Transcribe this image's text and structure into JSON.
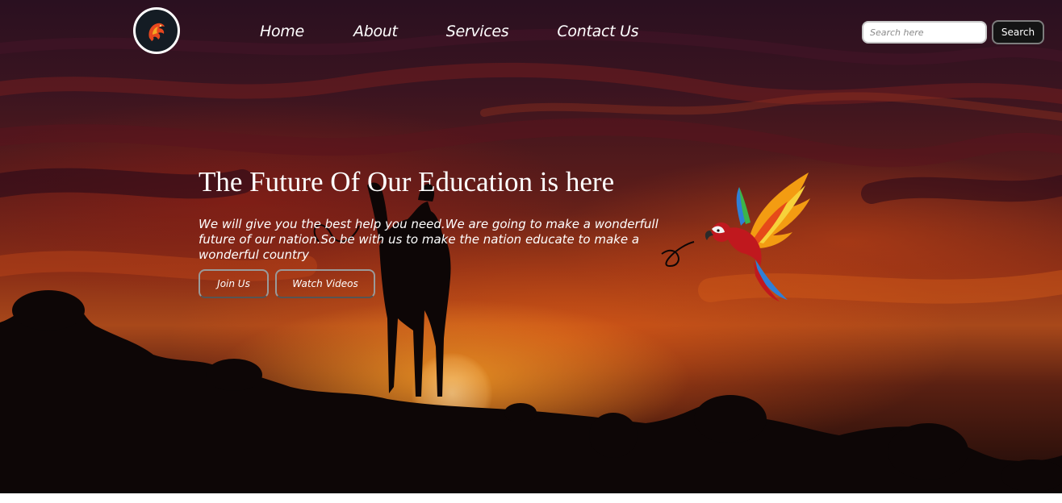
{
  "nav": {
    "items": [
      {
        "label": "Home"
      },
      {
        "label": "About"
      },
      {
        "label": "Services"
      },
      {
        "label": "Contact Us"
      }
    ]
  },
  "search": {
    "placeholder": "Search here",
    "button_label": "Search"
  },
  "hero": {
    "headline": "The Future Of Our Education is here",
    "subtext": "We will give you the best help you need.We are going to make a wonderfull future of our nation.So be with us to make the nation educate to make a wonderful country",
    "join_label": "Join Us",
    "watch_label": "Watch Videos"
  },
  "colors": {
    "text": "#ffffff",
    "logo_bg": "#141c24",
    "search_button_bg": "#141414"
  },
  "icons": {
    "logo": "dragon-logo-icon",
    "decoration": "parrot-illustration"
  }
}
